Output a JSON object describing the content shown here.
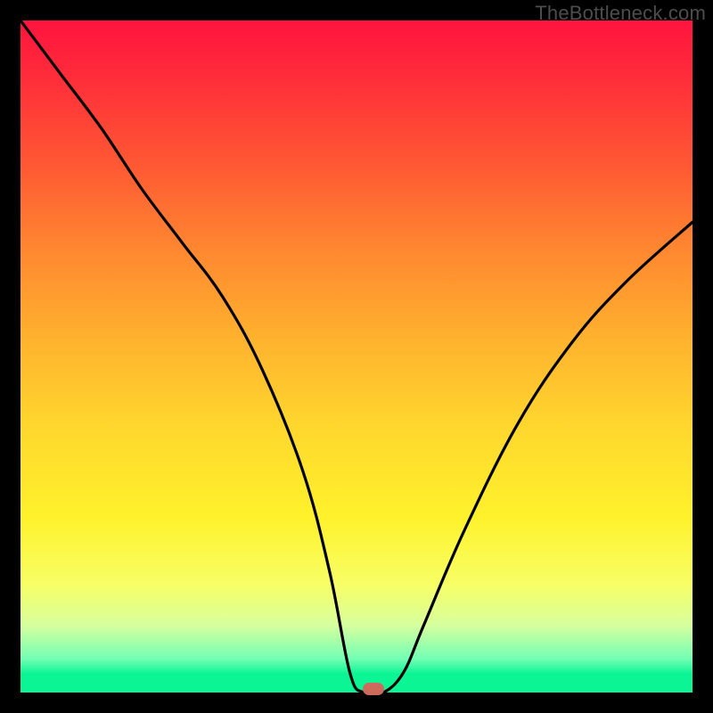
{
  "watermark": "TheBottleneck.com",
  "colors": {
    "frame": "#000000",
    "gradient_top": "#ff143e",
    "gradient_bottom": "#0cf594",
    "curve": "#000000",
    "marker": "#cc6b5b",
    "watermark_text": "#4d4d4d"
  },
  "chart_data": {
    "type": "line",
    "title": "",
    "xlabel": "",
    "ylabel": "",
    "xlim": [
      0,
      100
    ],
    "ylim": [
      0,
      100
    ],
    "grid": false,
    "series": [
      {
        "name": "bottleneck-curve",
        "x": [
          0,
          6,
          12,
          18,
          24,
          30,
          36,
          42,
          46,
          49,
          51,
          54,
          57,
          60,
          66,
          74,
          82,
          90,
          100
        ],
        "values": [
          100,
          92,
          84,
          75,
          67,
          59,
          48,
          33,
          18,
          3,
          0,
          0,
          3,
          10,
          24,
          40,
          52,
          61,
          70
        ]
      }
    ],
    "annotations": [
      {
        "name": "optimal-marker",
        "x": 52.5,
        "y": 0
      }
    ]
  }
}
